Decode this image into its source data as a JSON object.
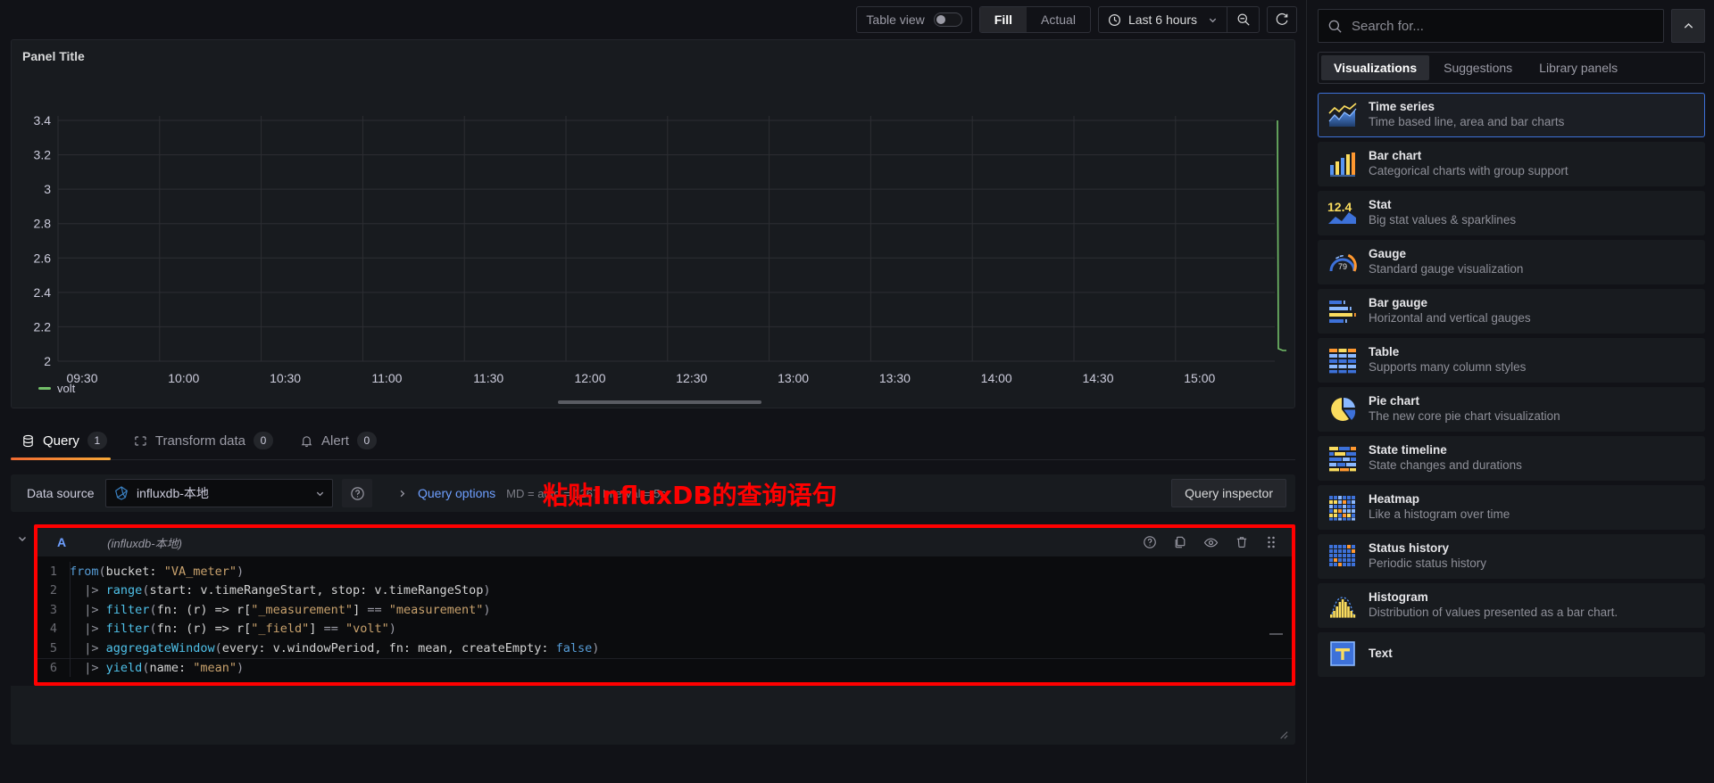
{
  "toolbar": {
    "table_view_label": "Table view",
    "table_view_on": false,
    "fill_label": "Fill",
    "actual_label": "Actual",
    "time_range": "Last 6 hours",
    "clock_icon": "clock-icon",
    "zoom_out_icon": "zoom-out-icon",
    "refresh_icon": "refresh-icon",
    "caret_icon": "chevron-down-icon"
  },
  "panel": {
    "title": "Panel Title",
    "legend": [
      {
        "label": "volt",
        "color": "#73bf69"
      }
    ]
  },
  "chart_data": {
    "type": "line",
    "title": "Panel Title",
    "xlabel": "",
    "ylabel": "",
    "ylim": [
      2,
      3.4
    ],
    "ytick_labels": [
      "3.4",
      "3.2",
      "3",
      "2.8",
      "2.6",
      "2.4",
      "2.2",
      "2"
    ],
    "ytick_values": [
      3.4,
      3.2,
      3,
      2.8,
      2.6,
      2.4,
      2.2,
      2
    ],
    "xtick_labels": [
      "09:30",
      "10:00",
      "10:30",
      "11:00",
      "11:30",
      "12:00",
      "12:30",
      "13:00",
      "13:30",
      "14:00",
      "14:30",
      "15:00"
    ],
    "grid": true,
    "legend_position": "bottom-left",
    "series": [
      {
        "name": "volt",
        "color": "#73bf69",
        "x": [
          "15:40",
          "15:41",
          "15:42"
        ],
        "values": [
          3.35,
          2.1,
          2.1
        ]
      }
    ]
  },
  "tabs": [
    {
      "label": "Query",
      "badge": "1",
      "icon": "database-icon",
      "active": true
    },
    {
      "label": "Transform data",
      "badge": "0",
      "icon": "transform-icon",
      "active": false
    },
    {
      "label": "Alert",
      "badge": "0",
      "icon": "bell-icon",
      "active": false
    }
  ],
  "datasource_row": {
    "label": "Data source",
    "selected": "influxdb-本地",
    "ds_icon": "influxdb-icon",
    "help_icon": "help-circle-icon",
    "query_options_label": "Query options",
    "query_options_meta": "MD = auto = 1267   Interval = 5s",
    "query_inspector_label": "Query inspector",
    "expand_icon": "chevron-right-icon"
  },
  "annotation": {
    "text": "粘贴InfluxDB的查询语句",
    "color": "#ff0000"
  },
  "query_row": {
    "ref_id": "A",
    "datasource_note": "(influxdb-本地)",
    "actions": [
      "help-circle-icon",
      "copy-icon",
      "eye-icon",
      "trash-icon",
      "drag-handle-icon"
    ],
    "code_lines": [
      {
        "n": "1",
        "text": "from(bucket: \"VA_meter\")"
      },
      {
        "n": "2",
        "text": "  |> range(start: v.timeRangeStart, stop: v.timeRangeStop)"
      },
      {
        "n": "3",
        "text": "  |> filter(fn: (r) => r[\"_measurement\"] == \"measurement\")"
      },
      {
        "n": "4",
        "text": "  |> filter(fn: (r) => r[\"_field\"] == \"volt\")"
      },
      {
        "n": "5",
        "text": "  |> aggregateWindow(every: v.windowPeriod, fn: mean, createEmpty: false)"
      },
      {
        "n": "6",
        "text": "  |> yield(name: \"mean\")"
      }
    ]
  },
  "sidebar": {
    "search_placeholder": "Search for...",
    "search_value": "",
    "search_icon": "search-icon",
    "collapse_icon": "chevron-up-icon",
    "tabs": [
      {
        "label": "Visualizations",
        "active": true
      },
      {
        "label": "Suggestions",
        "active": false
      },
      {
        "label": "Library panels",
        "active": false
      }
    ],
    "items": [
      {
        "name": "Time series",
        "desc": "Time based line, area and bar charts",
        "icon": "time-series-icon",
        "selected": true
      },
      {
        "name": "Bar chart",
        "desc": "Categorical charts with group support",
        "icon": "bar-chart-icon",
        "selected": false
      },
      {
        "name": "Stat",
        "desc": "Big stat values & sparklines",
        "icon": "stat-icon",
        "selected": false
      },
      {
        "name": "Gauge",
        "desc": "Standard gauge visualization",
        "icon": "gauge-icon",
        "selected": false
      },
      {
        "name": "Bar gauge",
        "desc": "Horizontal and vertical gauges",
        "icon": "bar-gauge-icon",
        "selected": false
      },
      {
        "name": "Table",
        "desc": "Supports many column styles",
        "icon": "table-icon",
        "selected": false
      },
      {
        "name": "Pie chart",
        "desc": "The new core pie chart visualization",
        "icon": "pie-chart-icon",
        "selected": false
      },
      {
        "name": "State timeline",
        "desc": "State changes and durations",
        "icon": "state-timeline-icon",
        "selected": false
      },
      {
        "name": "Heatmap",
        "desc": "Like a histogram over time",
        "icon": "heatmap-icon",
        "selected": false
      },
      {
        "name": "Status history",
        "desc": "Periodic status history",
        "icon": "status-history-icon",
        "selected": false
      },
      {
        "name": "Histogram",
        "desc": "Distribution of values presented as a bar chart.",
        "icon": "histogram-icon",
        "selected": false
      },
      {
        "name": "Text",
        "desc": "",
        "icon": "text-icon",
        "selected": false
      }
    ]
  },
  "stat_icon_value": "12.4",
  "gauge_icon_value": "79"
}
